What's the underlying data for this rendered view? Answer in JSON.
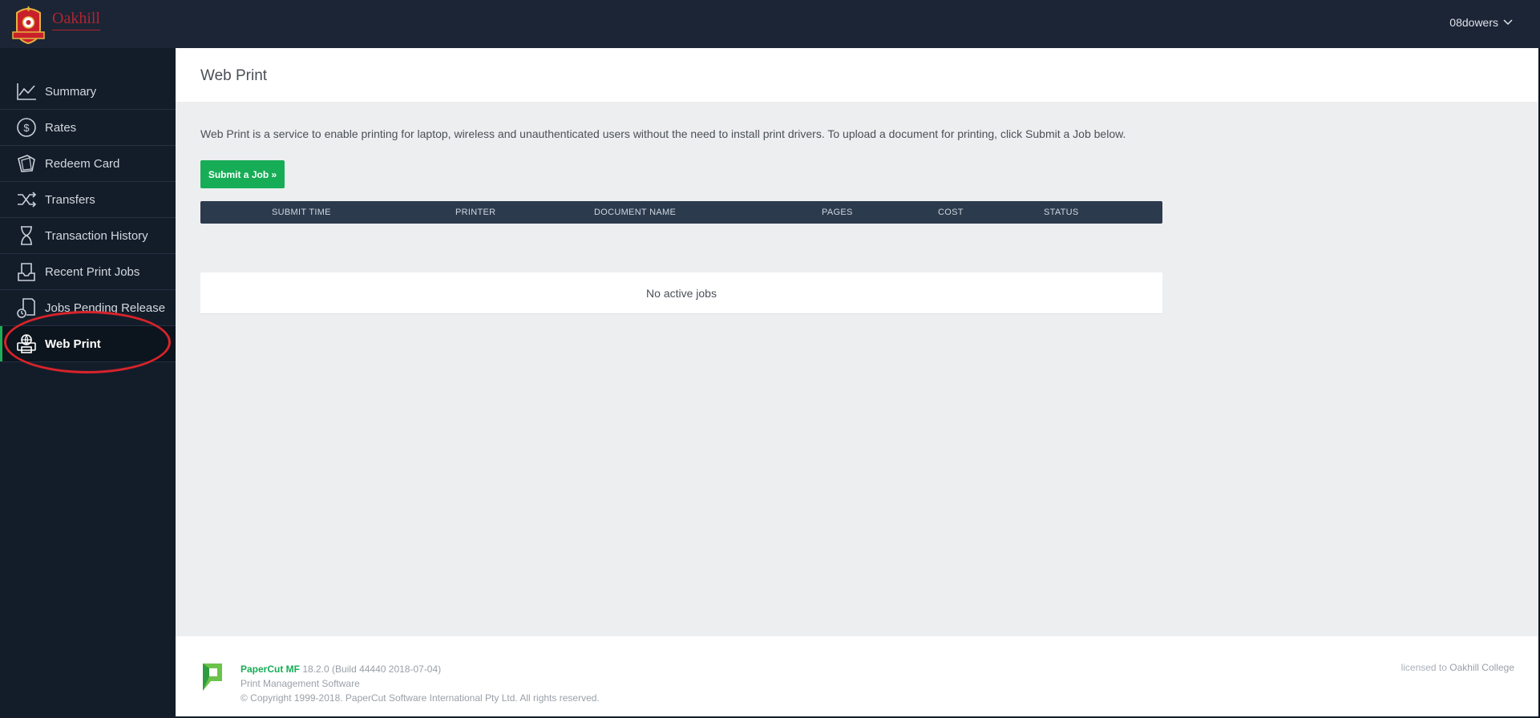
{
  "topbar": {
    "logo_text": "Oakhill",
    "user": "08dowers"
  },
  "sidebar": {
    "items": [
      {
        "label": "Summary",
        "icon": "line-chart-icon"
      },
      {
        "label": "Rates",
        "icon": "dollar-circle-icon"
      },
      {
        "label": "Redeem Card",
        "icon": "card-icon"
      },
      {
        "label": "Transfers",
        "icon": "shuffle-icon"
      },
      {
        "label": "Transaction History",
        "icon": "hourglass-icon"
      },
      {
        "label": "Recent Print Jobs",
        "icon": "inbox-tray-icon"
      },
      {
        "label": "Jobs Pending Release",
        "icon": "pending-print-icon"
      },
      {
        "label": "Web Print",
        "icon": "web-printer-icon",
        "active": true
      }
    ],
    "active_color": "#1fae57",
    "annotation_color": "#d8232a"
  },
  "page": {
    "title": "Web Print",
    "description": "Web Print is a service to enable printing for laptop, wireless and unauthenticated users without the need to install print drivers. To upload a document for printing, click Submit a Job below.",
    "submit_label": "Submit a Job »",
    "accent_color": "#17ad56"
  },
  "table": {
    "columns": [
      "SUBMIT TIME",
      "PRINTER",
      "DOCUMENT NAME",
      "PAGES",
      "COST",
      "STATUS"
    ],
    "empty_message": "No active jobs"
  },
  "footer": {
    "brand": "PaperCut MF",
    "version": "18.2.0 (Build 44440 2018-07-04)",
    "tagline": "Print Management Software",
    "copyright": "© Copyright 1999-2018. PaperCut Software International Pty Ltd. All rights reserved.",
    "licensed_prefix": "licensed to",
    "licensed_org": "Oakhill College"
  }
}
